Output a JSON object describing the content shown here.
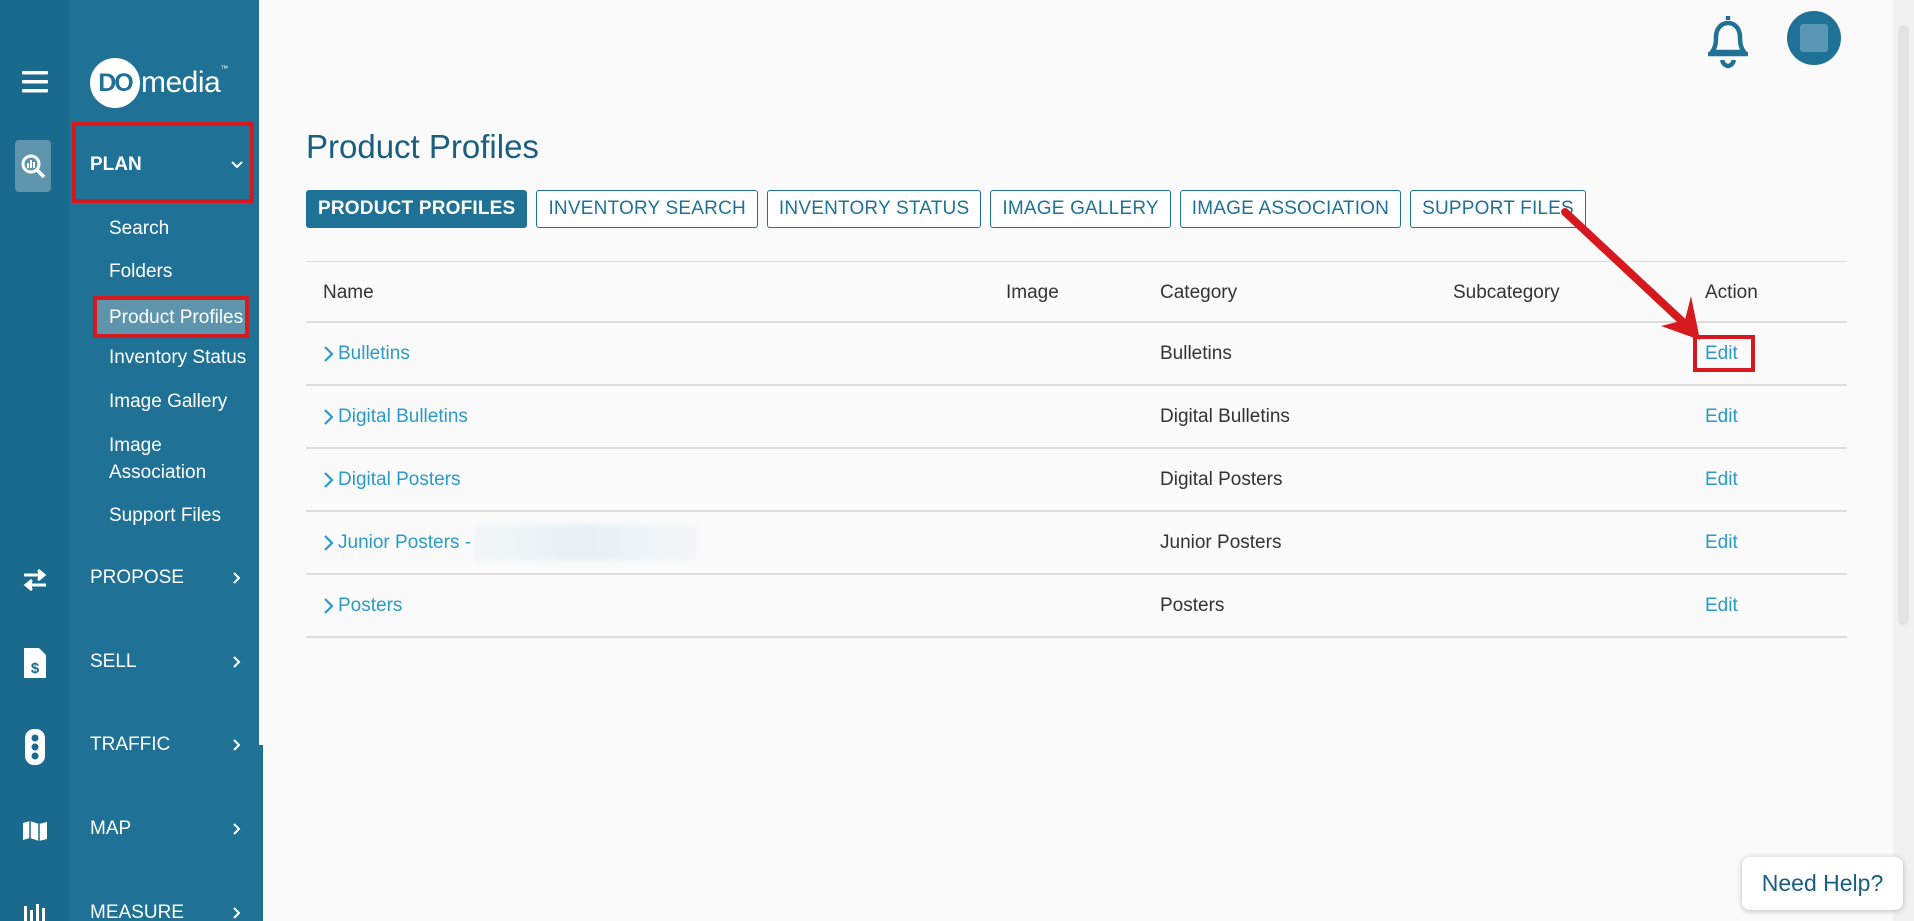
{
  "logo": {
    "badge": "DO",
    "word": "media",
    "tm": "™"
  },
  "nav": {
    "sections": [
      {
        "label": "PLAN",
        "expanded": true
      },
      {
        "label": "PROPOSE"
      },
      {
        "label": "SELL"
      },
      {
        "label": "TRAFFIC"
      },
      {
        "label": "MAP"
      },
      {
        "label": "MEASURE"
      }
    ],
    "plan_items": [
      "Search",
      "Folders",
      "Product Profiles",
      "Inventory Status",
      "Image Gallery",
      "Image Association",
      "Support Files"
    ],
    "active_item": "Product Profiles"
  },
  "page": {
    "title": "Product Profiles"
  },
  "tabs": [
    "PRODUCT PROFILES",
    "INVENTORY SEARCH",
    "INVENTORY STATUS",
    "IMAGE GALLERY",
    "IMAGE ASSOCIATION",
    "SUPPORT FILES"
  ],
  "table": {
    "columns": [
      "Name",
      "Image",
      "Category",
      "Subcategory",
      "Action"
    ],
    "rows": [
      {
        "name": "Bulletins",
        "category": "Bulletins",
        "action": "Edit"
      },
      {
        "name": "Digital Bulletins",
        "category": "Digital Bulletins",
        "action": "Edit"
      },
      {
        "name": "Digital Posters",
        "category": "Digital Posters",
        "action": "Edit"
      },
      {
        "name": "Junior Posters -",
        "category": "Junior Posters",
        "action": "Edit"
      },
      {
        "name": "Posters",
        "category": "Posters",
        "action": "Edit"
      }
    ]
  },
  "help": {
    "label": "Need Help?"
  },
  "colors": {
    "accent": "#1f7196",
    "link": "#2a9bc8",
    "highlight": "#d6191f"
  }
}
